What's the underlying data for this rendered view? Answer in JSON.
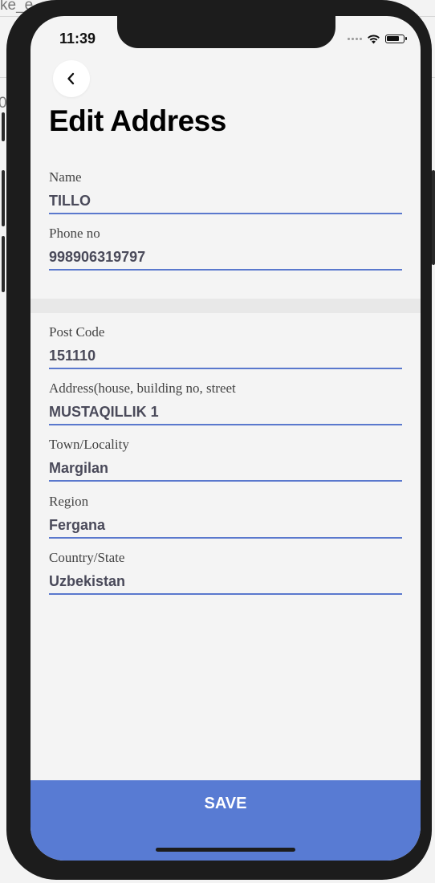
{
  "background": {
    "text_top": "ke_e",
    "text_left": "0"
  },
  "status_bar": {
    "time": "11:39"
  },
  "header": {
    "title": "Edit Address"
  },
  "contact_fields": [
    {
      "label": "Name",
      "value": "TILLO"
    },
    {
      "label": "Phone no",
      "value": "998906319797"
    }
  ],
  "address_fields": [
    {
      "label": "Post Code",
      "value": "151110"
    },
    {
      "label": "Address(house, building no, street",
      "value": "MUSTAQILLIK 1"
    },
    {
      "label": "Town/Locality",
      "value": "Margilan"
    },
    {
      "label": "Region",
      "value": "Fergana"
    },
    {
      "label": "Country/State",
      "value": "Uzbekistan"
    }
  ],
  "footer": {
    "save_label": "SAVE"
  },
  "colors": {
    "accent": "#587bd3",
    "underline": "#5a78cd",
    "screen_bg": "#f4f4f4",
    "section_divider": "#e8e8e8"
  },
  "icons": {
    "back": "chevron-left-icon",
    "wifi": "wifi-icon",
    "battery": "battery-icon",
    "signal": "signal-icon"
  }
}
